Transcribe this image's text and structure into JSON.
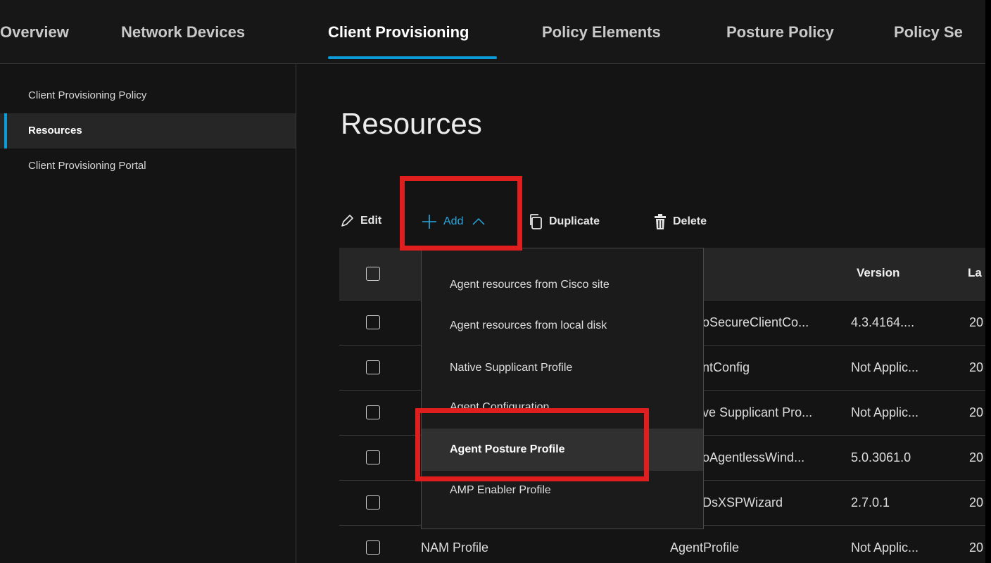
{
  "nav": {
    "tabs": [
      {
        "label": "Overview"
      },
      {
        "label": "Network Devices"
      },
      {
        "label": "Client Provisioning"
      },
      {
        "label": "Policy Elements"
      },
      {
        "label": "Posture Policy"
      },
      {
        "label": "Policy Se"
      }
    ],
    "active_tab": "Client Provisioning"
  },
  "sidebar": {
    "items": [
      {
        "label": "Client Provisioning Policy"
      },
      {
        "label": "Resources"
      },
      {
        "label": "Client Provisioning Portal"
      }
    ],
    "active_item": "Resources"
  },
  "main": {
    "title": "Resources",
    "toolbar": {
      "edit": "Edit",
      "add": "Add",
      "duplicate": "Duplicate",
      "delete": "Delete"
    },
    "table": {
      "columns": [
        "",
        "Version",
        "La"
      ],
      "rows": [
        {
          "name": "",
          "type": "oSecureClientCo...",
          "version": "4.3.4164....",
          "last": "20"
        },
        {
          "name": "",
          "type": "ntConfig",
          "version": "Not Applic...",
          "last": "20"
        },
        {
          "name": "",
          "type": "ve Supplicant Pro...",
          "version": "Not Applic...",
          "last": "20"
        },
        {
          "name": "",
          "type": "oAgentlessWind...",
          "version": "5.0.3061.0",
          "last": "20"
        },
        {
          "name": "",
          "type": "DsXSPWizard",
          "version": "2.7.0.1",
          "last": "20"
        },
        {
          "name": "NAM Profile",
          "type": "AgentProfile",
          "version": "Not Applic...",
          "last": "20"
        }
      ]
    },
    "add_menu": {
      "items": [
        {
          "label": "Agent resources from Cisco site"
        },
        {
          "label": "Agent resources from local disk"
        },
        {
          "label": "Native Supplicant Profile"
        },
        {
          "label": "Agent Configuration"
        },
        {
          "label": "Agent Posture Profile"
        },
        {
          "label": "AMP Enabler Profile"
        }
      ],
      "hovered": "Agent Posture Profile"
    }
  },
  "colors": {
    "accent": "#0d9bd8",
    "link": "#29a7e0",
    "highlight": "#e01e1e",
    "background": "#141414"
  }
}
